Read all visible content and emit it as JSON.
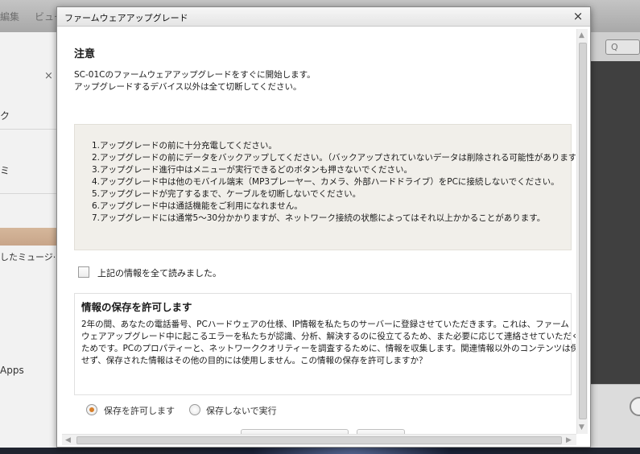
{
  "background_app": {
    "menu_edit": "編集",
    "menu_view": "ビュー",
    "sidebar_close": "×",
    "sidebar_text_1": "ク",
    "sidebar_text_2": "ミ",
    "sidebar_music": "したミュージ···",
    "sidebar_apps": "Apps",
    "search_glyph": "Q"
  },
  "dialog": {
    "title": "ファームウェアアップグレード",
    "close": "×",
    "notice_heading": "注意",
    "intro": [
      "SC-01Cのファームウェアアップグレードをすぐに開始します。",
      "アップグレードするデバイス以外は全て切断してください。"
    ],
    "rules": [
      "1.アップグレードの前に十分充電してください。",
      "2.アップグレードの前にデータをバックアップしてください。（バックアップされていないデータは削除される可能性があります）。",
      "3.アップグレード進行中はメニューが実行できるどのボタンも押さないでください。",
      "4.アップグレード中は他のモバイル端末（MP3プレーヤー、カメラ、外部ハードドライブ）をPCに接続しないでください。",
      "5.アップグレードが完了するまで、ケーブルを切断しないでください。",
      "6.アップグレード中は通話機能をご利用になれません。",
      "7.アップグレードには通常5〜30分かかりますが、ネットワーク接続の状態によってはそれ以上かかることがあります。"
    ],
    "ack_label": "上記の情報を全て読みました。",
    "info_heading": "情報の保存を許可します",
    "info_lines": [
      "2年の間、あなたの電話番号、PCハードウェアの仕様、IP情報を私たちのサーバーに登録させていただきます。これは、ファーム",
      "ウェアアップグレード中に起こるエラーを私たちが認識、分析、解決するのに役立てるため、また必要に応じて連絡させていただく",
      "ためです。PCのプロパティーと、ネットワーククオリティーを調査するために、情報を収集します。関連情報以外のコンテンツは保存",
      "せず、保存された情報はその他の目的には使用しません。この情報の保存を許可しますか？"
    ],
    "radio_allow": "保存を許可します",
    "radio_deny": "保存しないで実行",
    "selected_radio": "allow"
  },
  "colors": {
    "radio_accent": "#d77f2a",
    "rules_box_bg": "#f1efea"
  }
}
